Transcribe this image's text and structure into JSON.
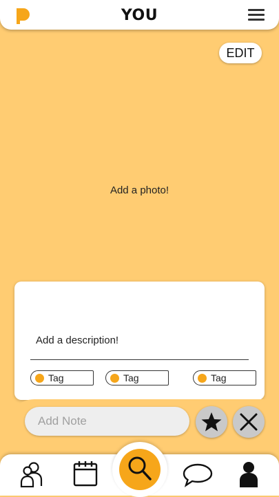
{
  "header": {
    "title": "YOU",
    "logo_icon": "p-logo-icon",
    "menu_icon": "hamburger-menu-icon"
  },
  "photo": {
    "edit_label": "EDIT",
    "placeholder": "Add a photo!"
  },
  "description": {
    "placeholder": "Add a description!",
    "tags": [
      {
        "label": "Tag"
      },
      {
        "label": "Tag"
      },
      {
        "label": "Tag"
      }
    ]
  },
  "note": {
    "placeholder": "Add Note",
    "favorite_icon": "star-icon",
    "dismiss_icon": "close-icon"
  },
  "bottom_nav": {
    "items": [
      "people-icon",
      "calendar-icon",
      "search-icon",
      "chat-icon",
      "profile-icon"
    ]
  },
  "colors": {
    "background": "#ffcc72",
    "accent": "#f6a61a",
    "card": "#ffffff",
    "button_gray": "#c9c9c9"
  }
}
